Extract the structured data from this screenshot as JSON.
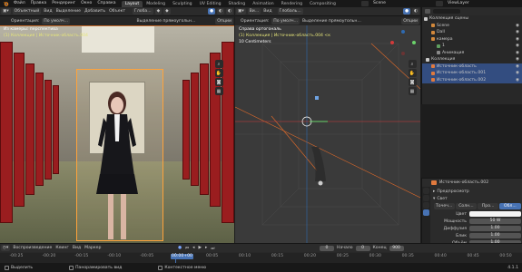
{
  "topbar": {
    "menus": [
      "Файл",
      "Правка",
      "Рендеринг",
      "Окно",
      "Справка"
    ],
    "workspaces": [
      "Layout",
      "Modeling",
      "Sculpting",
      "UV Editing",
      "Shading",
      "Animation",
      "Rendering",
      "Compositing"
    ],
    "active_workspace_index": 0,
    "scene": "Scene",
    "view_layer": "ViewLayer"
  },
  "left_viewport": {
    "header": [
      "Объектный",
      "Вид",
      "Выделение",
      "Добавить",
      "Объект"
    ],
    "sub_header": {
      "orientation": "Ориентация:",
      "orientation_value": "По умолч...",
      "drag": "Выделение прямоугольн...",
      "options": "Опции"
    },
    "transform_label": "Глоба...",
    "overlay_title": "Из камеры: перспектива",
    "overlay_subtitle": "(1) Коллекция | Источник-область.004"
  },
  "right_viewport": {
    "header": [
      "Ви...",
      "Вид"
    ],
    "transform_label": "Глобаль...",
    "sub_header": {
      "orientation": "Ориентация:",
      "orientation_value": "По умолч...",
      "drag": "Выделение прямоугольн...",
      "options": "Опции"
    },
    "overlay_title": "Справа ортогональ",
    "overlay_subtitle": "(1) Коллекция | Источник-область.004 <к",
    "overlay_scale": "10 Centimeters"
  },
  "outliner": {
    "title": "Коллекция сцены",
    "items": [
      {
        "label": "Scene",
        "color": "#d2883b",
        "selected": false,
        "indent": 1
      },
      {
        "label": "Dall",
        "color": "#d2883b",
        "selected": false,
        "indent": 1
      },
      {
        "label": "камера",
        "color": "#d2883b",
        "selected": false,
        "indent": 1
      },
      {
        "label": "1",
        "color": "#5f9e5f",
        "selected": false,
        "indent": 2
      },
      {
        "label": "Анимация",
        "color": "#8a8a8a",
        "selected": false,
        "indent": 2
      },
      {
        "label": "Коллекция",
        "color": "#c9c9c9",
        "selected": false,
        "indent": 0
      },
      {
        "label": "Источник-область",
        "color": "#e07a3e",
        "selected": true,
        "indent": 1
      },
      {
        "label": "Источник-область.001",
        "color": "#e07a3e",
        "selected": true,
        "indent": 1
      },
      {
        "label": "Источник-область.002",
        "color": "#e07a3e",
        "selected": true,
        "indent": 1
      }
    ]
  },
  "properties": {
    "object_name": "Источник-область.002",
    "sections": [
      "Предпросмотр",
      "Свет"
    ],
    "light_types": [
      "Точеч...",
      "Солн...",
      "Про...",
      "Обл..."
    ],
    "rows": [
      {
        "label": "Цвет",
        "value": ""
      },
      {
        "label": "Мощность",
        "value": "50 W"
      },
      {
        "label": "Диффузия",
        "value": "1.00"
      },
      {
        "label": "Блик",
        "value": "1.00"
      },
      {
        "label": "Объём",
        "value": "1.00"
      }
    ]
  },
  "timeline": {
    "menu": [
      "Воспроизведение",
      "Кеинг",
      "Вид",
      "Маркер"
    ],
    "ticks": [
      "-00:25",
      "-00:20",
      "-00:15",
      "-00:10",
      "-00:05",
      "00:00+00",
      "00:05",
      "00:10",
      "00:15",
      "00:20",
      "00:25",
      "00:30",
      "00:35",
      "00:40",
      "00:45",
      "00:50"
    ],
    "current_frame": "0",
    "start_label": "Начало",
    "start_value": "0",
    "end_label": "Конец",
    "end_value": "900",
    "playhead": "00:00+00"
  },
  "statusbar": {
    "items": [
      "Выделить",
      "Панорамировать вид",
      "Контекстное меню"
    ],
    "version": "4.1.1"
  },
  "colors": {
    "accent": "#4772b3",
    "selected_row": "#334d80",
    "locker_red": "#9a1d1f",
    "grid_orange": "#e06a2a"
  }
}
